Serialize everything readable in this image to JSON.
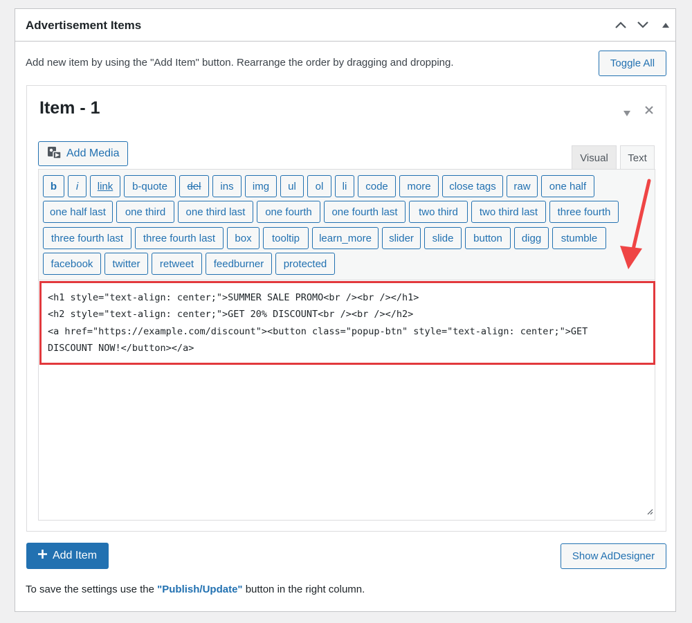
{
  "metabox": {
    "title": "Advertisement Items",
    "intro": "Add new item by using the \"Add Item\" button. Rearrange the order by dragging and dropping.",
    "toggle_all_label": "Toggle All"
  },
  "item": {
    "title": "Item - 1",
    "add_media_label": "Add Media",
    "tabs": {
      "visual": "Visual",
      "text": "Text"
    },
    "quicktags": [
      "b",
      "i",
      "link",
      "b-quote",
      "del",
      "ins",
      "img",
      "ul",
      "ol",
      "li",
      "code",
      "more",
      "close tags",
      "raw",
      "one half",
      "one half last",
      "one third",
      "one third last",
      "one fourth",
      "one fourth last",
      "two third",
      "two third last",
      "three fourth",
      "three fourth last",
      "box",
      "tooltip",
      "learn_more",
      "slider",
      "slide",
      "button",
      "digg",
      "stumble",
      "facebook",
      "twitter",
      "retweet",
      "feedburner",
      "protected"
    ],
    "code_lines": [
      "<h1 style=\"text-align: center;\">SUMMER SALE PROMO<br /><br /></h1>",
      "<h2 style=\"text-align: center;\">GET 20% DISCOUNT<br /><br /></h2>",
      "<a href=\"https://example.com/discount\"><button class=\"popup-btn\" style=\"text-align: center;\">GET",
      "DISCOUNT NOW!</button></a>"
    ]
  },
  "actions": {
    "add_item_label": "Add Item",
    "show_addesigner_label": "Show AdDesigner"
  },
  "footer": {
    "prefix": "To save the settings use the ",
    "highlight": "\"Publish/Update\"",
    "suffix": " button in the right column."
  },
  "colors": {
    "accent": "#2271b1",
    "highlight_border": "#e2393d"
  }
}
